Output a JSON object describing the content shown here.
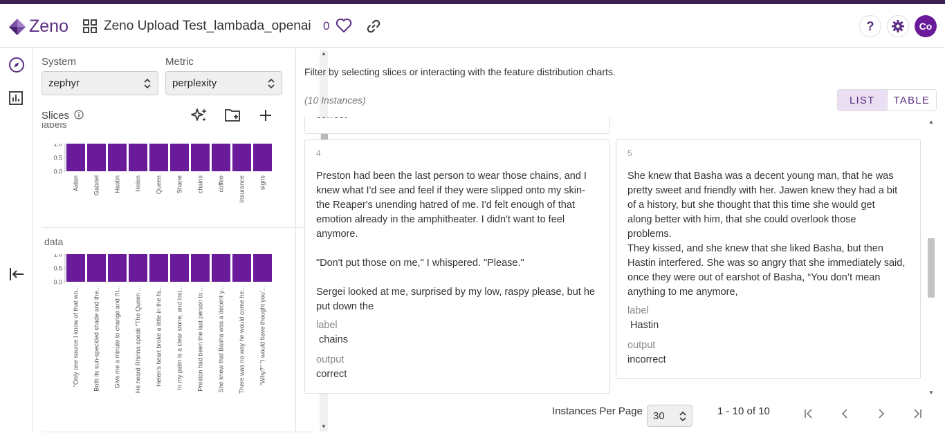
{
  "header": {
    "logo_text": "Zeno",
    "project_title": "Zeno Upload Test_lambada_openai",
    "like_count": "0",
    "avatar_initials": "Co"
  },
  "sidebar": {
    "system_label": "System",
    "system_value": "zephyr",
    "metric_label": "Metric",
    "metric_value": "perplexity",
    "slices_label": "Slices",
    "labels_section": "labels",
    "data_section": "data"
  },
  "chart_data": [
    {
      "type": "bar",
      "title": "labels",
      "categories": [
        "Aidan",
        "Gabriel",
        "Hastin",
        "Helen",
        "Queen",
        "Shane",
        "chains",
        "coffee",
        "Insurance",
        "signs"
      ],
      "values": [
        1.0,
        1.0,
        1.0,
        1.0,
        1.0,
        1.0,
        1.0,
        1.0,
        1.0,
        1.0
      ],
      "yticks": [
        "1.0",
        "0.5",
        "0.0"
      ],
      "ylim": [
        0,
        1
      ],
      "color": "#6a1b9a"
    },
    {
      "type": "bar",
      "title": "data",
      "categories": [
        "\"Only one source I know of that wo...",
        "Both its sun-speckled shade and the...",
        "Give me a minute to change and I'll...",
        "He heard Rhinna speak \"The Queen ...",
        "Helen's heart broke a little in the fa...",
        "In my palm is a clear stone, and insi...",
        "Preston had been the last person to ...",
        "She knew that Basha was a decent y...",
        "There was no way he would come he...",
        "\"Why?\" \"I would have thought you'..."
      ],
      "values": [
        1.0,
        1.0,
        1.0,
        1.0,
        1.0,
        1.0,
        1.0,
        1.0,
        1.0,
        1.0
      ],
      "yticks": [
        "1.0",
        "0.5",
        "0.0"
      ],
      "ylim": [
        0,
        1
      ],
      "color": "#6a1b9a"
    }
  ],
  "main": {
    "hint": "Filter by selecting slices or interacting with the feature distribution charts.",
    "instances_count": "(10 Instances)",
    "view_list": "LIST",
    "view_table": "TABLE",
    "prev_card_output": "correct",
    "cards": [
      {
        "index": "4",
        "text": "Preston had been the last person to wear those chains, and I\nknew what I'd see and feel if they were slipped onto my skin-\nthe Reaper's unending hatred of me. I'd felt enough of that\nemotion already in the amphitheater. I didn't want to feel\nanymore.\n\n\"Don't put those on me,\" I whispered. \"Please.\"\n\nSergei looked at me, surprised by my low, raspy please, but he\nput down the",
        "label_key": "label",
        "label_value": " chains",
        "output_key": "output",
        "output_value": "correct"
      },
      {
        "index": "5",
        "text": "She knew that Basha was a decent young man, that he was\npretty sweet and friendly with her. Jawen knew they had a bit\nof a history, but she thought that this time she would get\nalong better with him, that she could overlook those\nproblems.\nThey kissed, and she knew that she liked Basha, but then\nHastin interfered. She was so angry that she immediately said,\nonce they were out of earshot of Basha, “You don’t mean\nanything to me anymore,",
        "label_key": "label",
        "label_value": " Hastin",
        "output_key": "output",
        "output_value": "incorrect"
      }
    ],
    "per_page_label": "Instances Per Page",
    "per_page_value": "30",
    "range": "1 - 10 of 10"
  }
}
